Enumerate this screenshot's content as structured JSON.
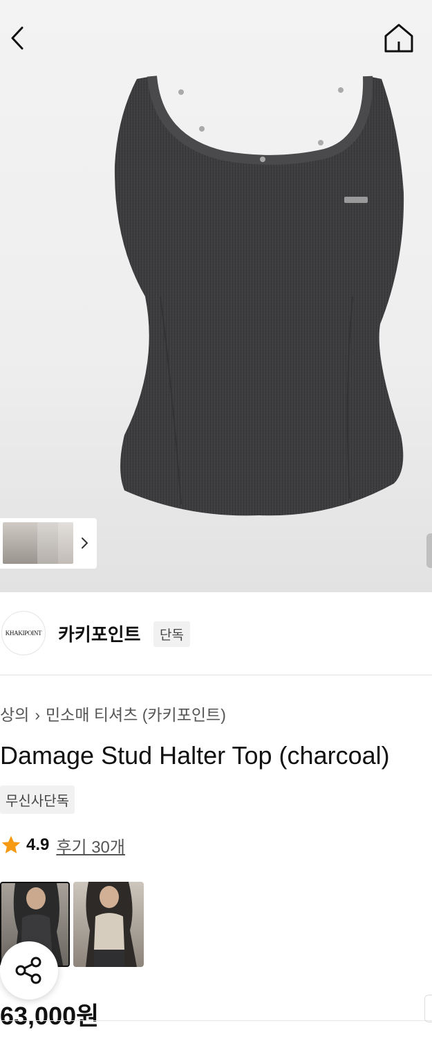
{
  "nav": {
    "back_icon": "chevron-left-icon",
    "home_icon": "home-icon"
  },
  "brand": {
    "logo_text": "KHAKIPOINT",
    "name": "카키포인트",
    "tag": "단독"
  },
  "breadcrumb": {
    "category": "상의",
    "separator_icon": "chevron-right-icon",
    "subcategory": "민소매 티셔츠 (카키포인트)"
  },
  "product": {
    "title": "Damage Stud Halter Top (charcoal)",
    "exclusive_tag": "무신사단독",
    "rating": "4.9",
    "reviews": "후기 30개",
    "price": "63,000원"
  },
  "colors": {
    "star": "#f59a12",
    "garment": "#3a3a3c"
  }
}
